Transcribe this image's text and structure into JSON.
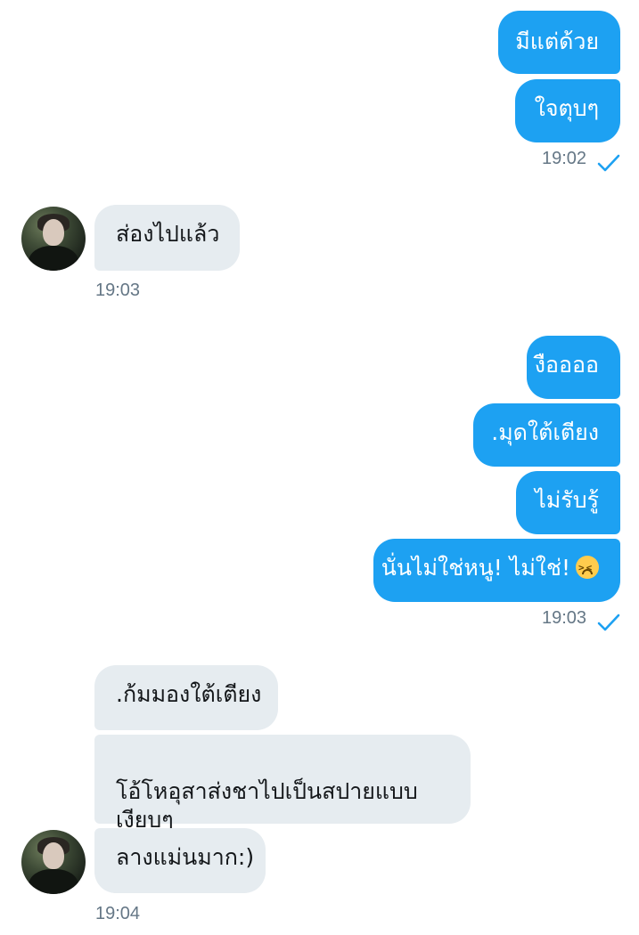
{
  "messages": {
    "m1": {
      "text": "มีแต่ด้วย"
    },
    "m2": {
      "text": "ใจตุบๆ"
    },
    "m3": {
      "text": "ส่องไปแล้ว"
    },
    "m4": {
      "text": "งืออออ"
    },
    "m5": {
      "text": ".มุดใต้เตียง"
    },
    "m6": {
      "text": "ไม่รับรู้"
    },
    "m7": {
      "text": "นั่นไม่ใช่หนู! ไม่ใช่!"
    },
    "m8": {
      "text": ".ก้มมองใต้เตียง"
    },
    "m9": {
      "text": "โอ้โหอุสาส่งชาไปเป็นสปายแบบ\nเงียบๆ"
    },
    "m10": {
      "text": "ลางแม่นมาก:)"
    }
  },
  "timestamps": {
    "t1": "19:02",
    "t2": "19:03",
    "t3": "19:03",
    "t4": "19:04"
  },
  "icons": {
    "sent_check": "checkmark-icon",
    "emoji": "confounded-face-emoji"
  },
  "colors": {
    "outgoing_bubble": "#1da1f2",
    "incoming_bubble": "#e6ecf0",
    "timestamp": "#657786",
    "check": "#1da1f2"
  }
}
